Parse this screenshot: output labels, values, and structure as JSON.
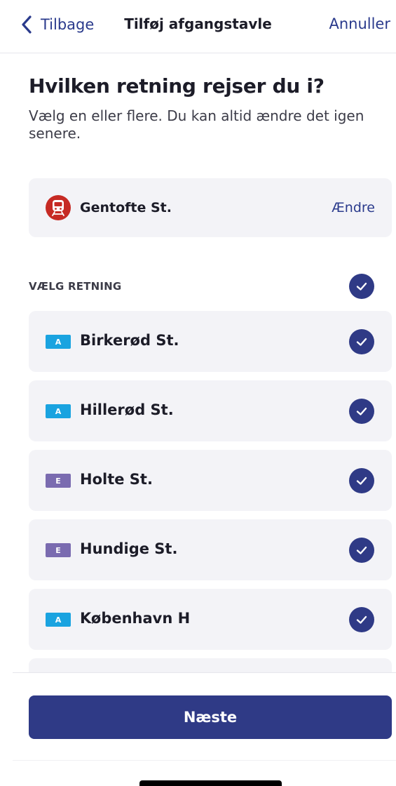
{
  "colors": {
    "accent": "#2f3a86",
    "link": "#2a3a8c",
    "station_red": "#c62a24",
    "badge_A": "#1aa3e0",
    "badge_E": "#7a6bb0",
    "card_bg": "#f3f3f7"
  },
  "navbar": {
    "back_label": "Tilbage",
    "back_icon": "chevron-left-icon",
    "title": "Tilføj afgangstavle",
    "cancel_label": "Annuller"
  },
  "heading": "Hvilken retning rejser du i?",
  "subtitle": "Vælg en eller flere. Du kan altid ændre det igen senere.",
  "station": {
    "icon": "train-icon",
    "name": "Gentofte St.",
    "change_label": "Ændre"
  },
  "section": {
    "label": "VÆLG RETNING",
    "all_selected": true
  },
  "directions": [
    {
      "line": "A",
      "name": "Birkerød St.",
      "selected": true
    },
    {
      "line": "A",
      "name": "Hillerød St.",
      "selected": true
    },
    {
      "line": "E",
      "name": "Holte St.",
      "selected": true
    },
    {
      "line": "E",
      "name": "Hundige St.",
      "selected": true
    },
    {
      "line": "A",
      "name": "København H",
      "selected": true
    }
  ],
  "next_button_label": "Næste"
}
